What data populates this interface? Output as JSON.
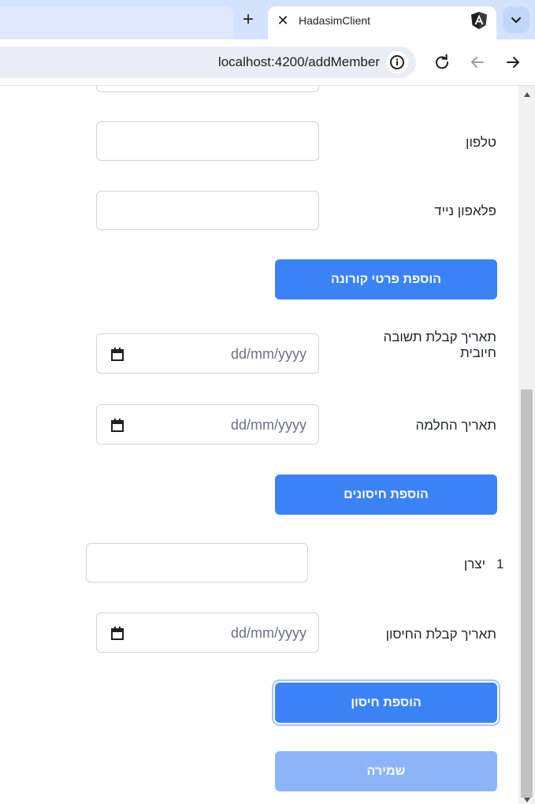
{
  "browser": {
    "tab_title": "HadasimClient",
    "url": "localhost:4200/addMember",
    "new_tab_symbol": "+",
    "close_symbol": "✕",
    "favicon": "angular-icon"
  },
  "form": {
    "phone_label": "טלפון",
    "mobile_label": "פלאפון נייד",
    "add_corona_button": "הוספת פרטי קורונה",
    "positive_date_label": "תאריך קבלת תשובה חיובית",
    "recovery_date_label": "תאריך החלמה",
    "add_vaccines_button": "הוספת חיסונים",
    "vaccine_number": "1",
    "manufacturer_label": "יצרן",
    "vaccine_date_label": "תאריך קבלת החיסון",
    "add_vaccine_button": "הוספת חיסון",
    "save_button": "שמירה",
    "date_placeholder": "dd/mm/yyyy"
  },
  "colors": {
    "primary": "#3b82f6",
    "primary_disabled": "#8cb4f8",
    "tab_strip": "#d3e3fd"
  }
}
